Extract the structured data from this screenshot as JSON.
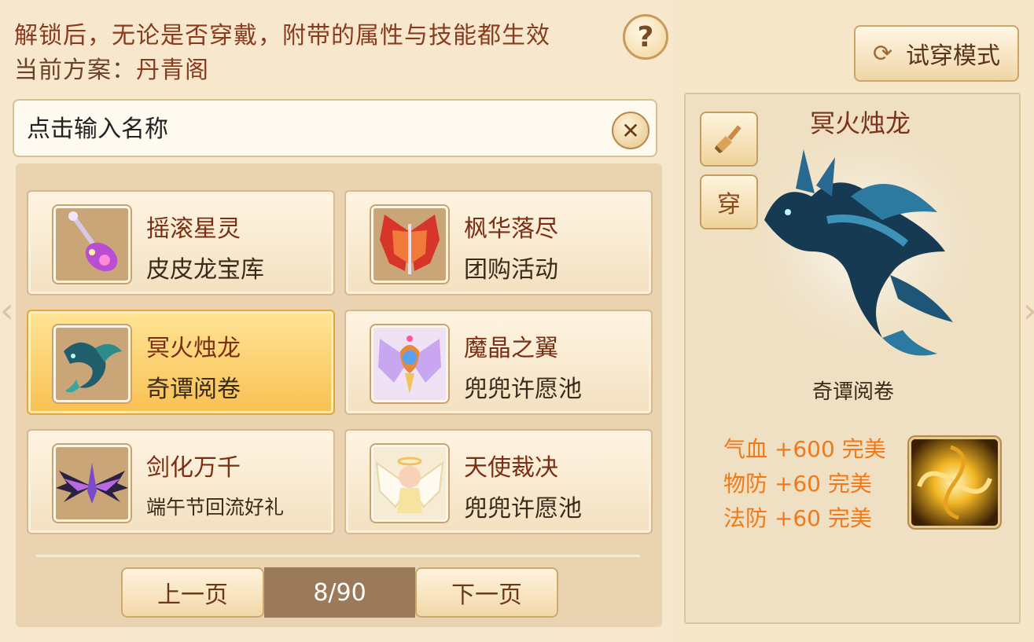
{
  "notice": {
    "line1": "解锁后，无论是否穿戴，附带的属性与技能都生效",
    "scheme_label": "当前方案：",
    "scheme_name": "丹青阁"
  },
  "help_label": "?",
  "search": {
    "placeholder": "点击输入名称",
    "clear_label": "✕"
  },
  "items": [
    {
      "name": "摇滚星灵",
      "source": "皮皮龙宝库",
      "icon": "rock-guitar-icon",
      "selected": false
    },
    {
      "name": "枫华落尽",
      "source": "团购活动",
      "icon": "maple-wings-icon",
      "selected": false
    },
    {
      "name": "冥火烛龙",
      "source": "奇谭阅卷",
      "icon": "nether-dragon-icon",
      "selected": true
    },
    {
      "name": "魔晶之翼",
      "source": "兜兜许愿池",
      "icon": "crystal-wings-icon",
      "selected": false
    },
    {
      "name": "剑化万千",
      "source": "端午节回流好礼",
      "icon": "sword-wings-icon",
      "selected": false
    },
    {
      "name": "天使裁决",
      "source": "兜兜许愿池",
      "icon": "angel-wings-icon",
      "selected": false
    }
  ],
  "pager": {
    "prev_label": "上一页",
    "next_label": "下一页",
    "page_text": "8/90"
  },
  "try_mode_label": "试穿模式",
  "preview": {
    "name": "冥火烛龙",
    "source": "奇谭阅卷",
    "wear_label": "穿",
    "stats": [
      "气血 +600 完美",
      "物防 +60 完美",
      "法防 +60 完美"
    ]
  },
  "colors": {
    "accent": "#f6b23a",
    "stat_text": "#f07a1a",
    "title_text": "#7a2e14"
  }
}
